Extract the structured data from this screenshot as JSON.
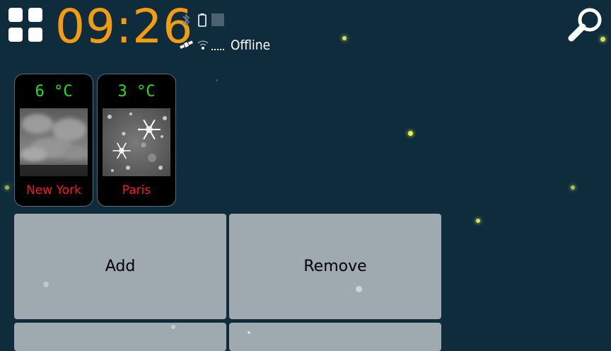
{
  "status_bar": {
    "time": "09:26",
    "network_status": "Offline"
  },
  "weather": [
    {
      "temperature": "6 °C",
      "city": "New York",
      "condition_icon": "cloudy-icon"
    },
    {
      "temperature": "3 °C",
      "city": "Paris",
      "condition_icon": "snow-icon"
    }
  ],
  "actions": {
    "add_label": "Add",
    "remove_label": "Remove"
  },
  "colors": {
    "background": "#0f2c3d",
    "clock": "#f39c12",
    "temperature": "#1fe01f",
    "city": "#ff1a1a",
    "button": "#9ea9b0"
  },
  "icons": [
    "apps-grid-icon",
    "bluetooth-icon",
    "battery-icon",
    "signal-icon",
    "satellite-icon",
    "wifi-icon",
    "search-icon"
  ]
}
